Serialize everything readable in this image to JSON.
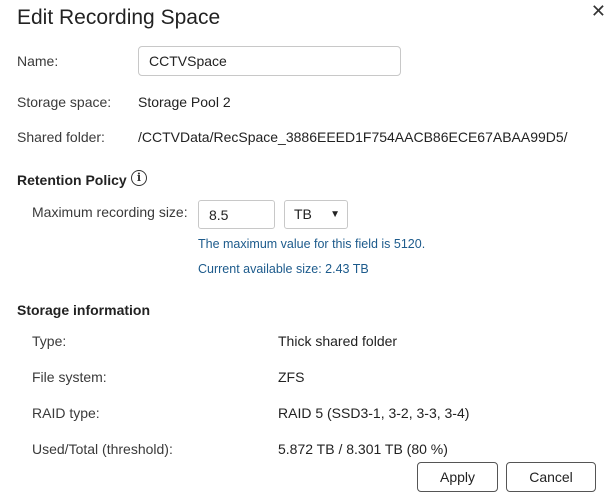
{
  "dialog": {
    "title": "Edit Recording Space",
    "close_icon": "close-icon"
  },
  "form": {
    "name_label": "Name:",
    "name_value": "CCTVSpace",
    "storage_space_label": "Storage space:",
    "storage_space_value": "Storage Pool 2",
    "shared_folder_label": "Shared folder:",
    "shared_folder_value": "/CCTVData/RecSpace_3886EEED1F754AACB86ECE67ABAA99D5/"
  },
  "retention": {
    "title": "Retention Policy",
    "info_icon": "info-icon",
    "max_size_label": "Maximum recording size:",
    "max_size_value": "8.5",
    "unit_value": "TB",
    "hint_max": "The maximum value for this field is 5120.",
    "hint_available": "Current available size: 2.43 TB",
    "hint_color": "#1d5b8c"
  },
  "storage_info": {
    "title": "Storage information",
    "type_label": "Type:",
    "type_value": "Thick shared folder",
    "fs_label": "File system:",
    "fs_value": "ZFS",
    "raid_label": "RAID type:",
    "raid_value": "RAID 5 (SSD3-1, 3-2, 3-3, 3-4)",
    "used_label": "Used/Total (threshold):",
    "used_value": "5.872 TB / 8.301 TB (80 %)"
  },
  "buttons": {
    "apply": "Apply",
    "cancel": "Cancel"
  }
}
